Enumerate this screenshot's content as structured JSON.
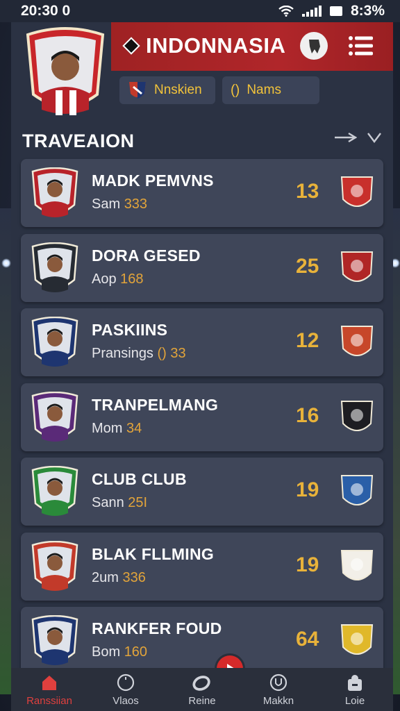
{
  "status_bar": {
    "time": "20:30 0",
    "battery": "8:3%"
  },
  "header": {
    "country": "INDONNASIA"
  },
  "chips": [
    {
      "label": "Nnskien"
    },
    {
      "label": "Nams",
      "icon": "()"
    }
  ],
  "section": {
    "title": "TRAVEAION"
  },
  "players": [
    {
      "name": "MADK PEMVNS",
      "sub_label": "Sam ",
      "sub_value": "333",
      "score": "13",
      "accent": "#b8232a",
      "badge_color": "#c8302c"
    },
    {
      "name": "DORA GESED",
      "sub_label": "Aop ",
      "sub_value": "168",
      "score": "25",
      "accent": "#262b33",
      "badge_color": "#b02626"
    },
    {
      "name": "PASKIINS",
      "sub_label": "Pransings ",
      "sub_value": "() 33",
      "score": "12",
      "accent": "#1e3570",
      "badge_color": "#c7472a"
    },
    {
      "name": "TRANPELMANG",
      "sub_label": "Mom ",
      "sub_value": "34",
      "score": "16",
      "accent": "#5a2a78",
      "badge_color": "#1d1d22"
    },
    {
      "name": "CLUB CLUB",
      "sub_label": "Sann ",
      "sub_value": "25I",
      "score": "19",
      "accent": "#2a8a3a",
      "badge_color": "#2a5fa8"
    },
    {
      "name": "BLAK FLLMING",
      "sub_label": "2um ",
      "sub_value": "336",
      "score": "19",
      "accent": "#c23a2a",
      "badge_color": "#f2efe8"
    },
    {
      "name": "RANKFER FOUD",
      "sub_label": "Bom ",
      "sub_value": "160",
      "score": "64",
      "accent": "#1e3570",
      "badge_color": "#e0b82a"
    }
  ],
  "bottom_nav": [
    {
      "label": "Ranssiian",
      "icon": "home-icon",
      "active": true
    },
    {
      "label": "Vlaos",
      "icon": "circle-icon",
      "active": false
    },
    {
      "label": "Reine",
      "icon": "ring-icon",
      "active": false
    },
    {
      "label": "Makkn",
      "icon": "u-icon",
      "active": false
    },
    {
      "label": "Loie",
      "icon": "lock-icon",
      "active": false
    }
  ],
  "colors": {
    "header_red": "#b0262a",
    "score_gold": "#e8b23a",
    "active_red": "#e0403e"
  }
}
